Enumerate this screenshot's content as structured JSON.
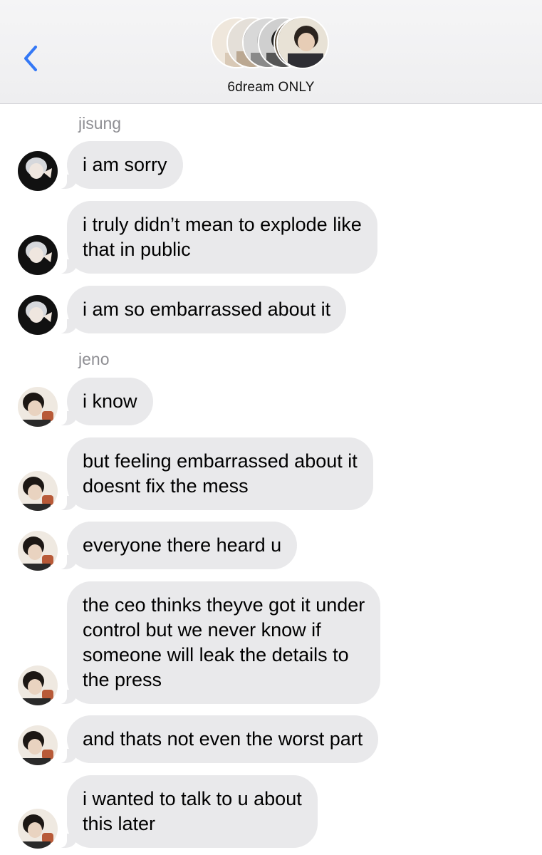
{
  "header": {
    "group_name": "6dream ONLY",
    "back_icon": "chevron-left-icon",
    "accent_color": "#3478f6"
  },
  "colors": {
    "bubble_incoming": "#e9e9eb",
    "sender_label": "#8e8e93"
  },
  "messages": [
    {
      "sender": "jisung",
      "text": "i am sorry"
    },
    {
      "sender": "jisung",
      "text": "i truly didn’t mean to explode like\nthat in public"
    },
    {
      "sender": "jisung",
      "text": "i am so embarrassed about it"
    },
    {
      "sender": "jeno",
      "text": "i know"
    },
    {
      "sender": "jeno",
      "text": "but feeling embarrassed about it\ndoesnt fix the mess"
    },
    {
      "sender": "jeno",
      "text": "everyone there heard u"
    },
    {
      "sender": "jeno",
      "text": "the ceo thinks theyve got it under\ncontrol but we never know if\nsomeone will leak the details to\nthe press"
    },
    {
      "sender": "jeno",
      "text": "and thats not even the worst part"
    },
    {
      "sender": "jeno",
      "text": "i wanted to talk to u about\nthis later"
    }
  ]
}
